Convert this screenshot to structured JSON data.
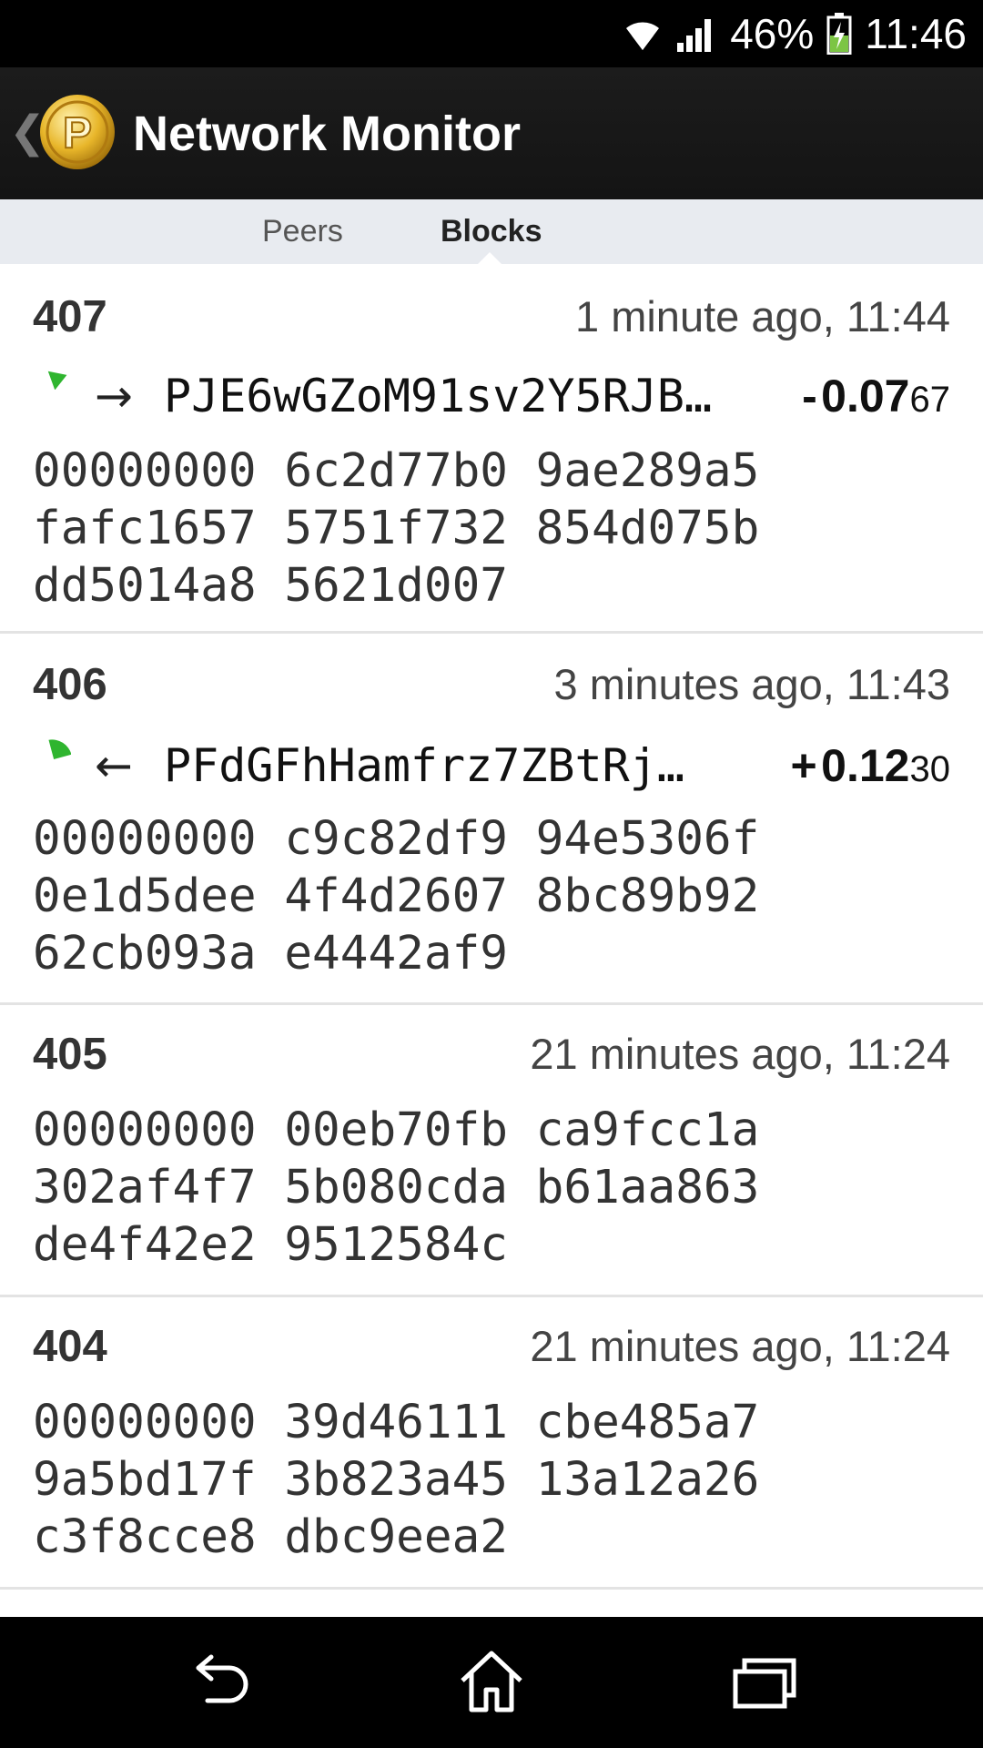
{
  "status_bar": {
    "battery": "46%",
    "time": "11:46"
  },
  "app": {
    "title": "Network Monitor",
    "icon_letter": "P"
  },
  "tabs": [
    {
      "label": "Peers",
      "selected": false
    },
    {
      "label": "Blocks",
      "selected": true
    }
  ],
  "blocks": [
    {
      "number": "407",
      "time": "1 minute ago, 11:44",
      "tx": {
        "direction": "→",
        "address": "PJE6wGZoM91sv2Y5RJB…",
        "sign": "-",
        "amount_main": "0.07",
        "amount_small": "67"
      },
      "hash": [
        "00000000 6c2d77b0 9ae289a5",
        "fafc1657 5751f732 854d075b",
        "dd5014a8 5621d007"
      ]
    },
    {
      "number": "406",
      "time": "3 minutes ago, 11:43",
      "tx": {
        "direction": "←",
        "address": "PFdGFhHamfrz7ZBtRj…",
        "sign": "+",
        "amount_main": "0.12",
        "amount_small": "30"
      },
      "hash": [
        "00000000 c9c82df9 94e5306f",
        "0e1d5dee 4f4d2607 8bc89b92",
        "62cb093a e4442af9"
      ]
    },
    {
      "number": "405",
      "time": "21 minutes ago, 11:24",
      "hash": [
        "00000000 00eb70fb ca9fcc1a",
        "302af4f7 5b080cda b61aa863",
        "de4f42e2 9512584c"
      ]
    },
    {
      "number": "404",
      "time": "21 minutes ago, 11:24",
      "hash": [
        "00000000 39d46111 cbe485a7",
        "9a5bd17f 3b823a45 13a12a26",
        "c3f8cce8 dbc9eea2"
      ]
    }
  ],
  "colors": {
    "confirm_green": "#2fb52f",
    "action_bar": "#1a1a1a",
    "tab_bar": "#e8ebf0",
    "coin_gold": "#e8b62a"
  }
}
